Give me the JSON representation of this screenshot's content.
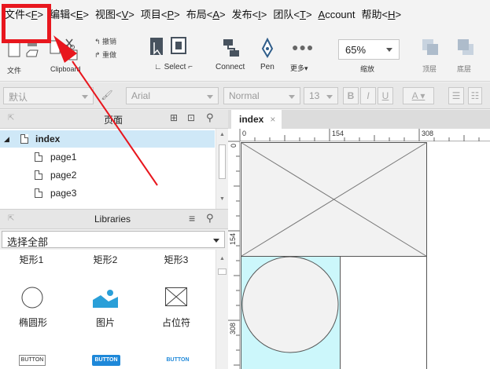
{
  "menu": [
    {
      "label": "文件<",
      "key": "F",
      "suffix": ">"
    },
    {
      "label": "编辑<",
      "key": "E",
      "suffix": ">"
    },
    {
      "label": "视图<",
      "key": "V",
      "suffix": ">"
    },
    {
      "label": "项目<",
      "key": "P",
      "suffix": ">"
    },
    {
      "label": "布局<",
      "key": "A",
      "suffix": ">"
    },
    {
      "label": "发布<",
      "key": "I",
      "suffix": ">"
    },
    {
      "label": "团队<",
      "key": "T",
      "suffix": ">"
    },
    {
      "label": "",
      "key": "A",
      "suffix": "ccount"
    },
    {
      "label": "帮助<",
      "key": "H",
      "suffix": ">"
    }
  ],
  "toolbar": {
    "file_label": "文件",
    "clipboard_label": "Clipboard",
    "undo_label": "撤销",
    "redo_label": "重做",
    "select_label": "Select",
    "connect_label": "Connect",
    "pen_label": "Pen",
    "more_label": "更多▾",
    "zoom_value": "65%",
    "zoom_label": "缩放",
    "top_label": "顶层",
    "bottom_label": "底层"
  },
  "formatbar": {
    "style_value": "默认",
    "font_value": "Arial",
    "weight_value": "Normal",
    "size_value": "13",
    "bold": "B",
    "italic": "I",
    "underline": "U",
    "color": "A"
  },
  "pages": {
    "title": "页面",
    "root": "index",
    "children": [
      "page1",
      "page2",
      "page3"
    ]
  },
  "libraries": {
    "title": "Libraries",
    "select_value": "选择全部",
    "row1": [
      "矩形1",
      "矩形2",
      "矩形3"
    ],
    "row2": [
      "椭圆形",
      "图片",
      "占位符"
    ],
    "row3": [
      "BUTTON",
      "BUTTON",
      "BUTTON"
    ]
  },
  "canvas": {
    "tab": "index",
    "tab_close": "×",
    "ruler_h": [
      "0",
      "154",
      "308"
    ],
    "ruler_v": [
      "0",
      "154",
      "308"
    ]
  },
  "colors": {
    "highlight": "#e8171e",
    "selected_row": "#cfe8f7",
    "canvas_fill": "#ccf7fb",
    "primary_button": "#1e88d9",
    "image_icon": "#2a9fd8"
  }
}
